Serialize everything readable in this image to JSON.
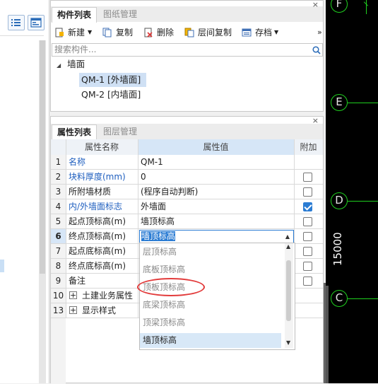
{
  "drawing": {
    "axes": [
      "F",
      "E",
      "D",
      "C"
    ],
    "dimension": "15000"
  },
  "component_panel": {
    "tabs": [
      "构件列表",
      "图纸管理"
    ],
    "toolbar": {
      "new": "新建",
      "copy": "复制",
      "delete": "删除",
      "floor_copy": "层间复制",
      "save": "存档",
      "more": "»"
    },
    "search_placeholder": "搜索构件...",
    "tree": {
      "root": "墙面",
      "items": [
        "QM-1 [外墙面]",
        "QM-2 [内墙面]"
      ],
      "selected_index": 0
    },
    "close": "×"
  },
  "property_panel": {
    "tabs": [
      "属性列表",
      "图层管理"
    ],
    "close": "×",
    "headers": {
      "name": "属性名称",
      "value": "属性值",
      "extra": "附加"
    },
    "rows": [
      {
        "num": "1",
        "name": "名称",
        "value": "QM-1",
        "blue": true,
        "checkbox": false,
        "checked": false
      },
      {
        "num": "2",
        "name": "块料厚度(mm)",
        "value": "0",
        "blue": true,
        "checkbox": true,
        "checked": false
      },
      {
        "num": "3",
        "name": "所附墙材质",
        "value": "(程序自动判断)",
        "blue": false,
        "checkbox": true,
        "checked": false
      },
      {
        "num": "4",
        "name": "内/外墙面标志",
        "value": "外墙面",
        "blue": true,
        "checkbox": true,
        "checked": true
      },
      {
        "num": "5",
        "name": "起点顶标高(m)",
        "value": "墙顶标高",
        "blue": false,
        "checkbox": true,
        "checked": false
      },
      {
        "num": "6",
        "name": "终点顶标高(m)",
        "value": "墙顶标高",
        "blue": false,
        "checkbox": true,
        "checked": false
      },
      {
        "num": "7",
        "name": "起点底标高(m)",
        "value": "",
        "blue": false,
        "checkbox": true,
        "checked": false
      },
      {
        "num": "8",
        "name": "终点底标高(m)",
        "value": "",
        "blue": false,
        "checkbox": true,
        "checked": false
      },
      {
        "num": "9",
        "name": "备注",
        "value": "",
        "blue": false,
        "checkbox": true,
        "checked": false
      },
      {
        "num": "10",
        "name": "土建业务属性",
        "value": "",
        "blue": false,
        "checkbox": false,
        "checked": false
      },
      {
        "num": "13",
        "name": "显示样式",
        "value": "",
        "blue": false,
        "checkbox": false,
        "checked": false
      }
    ],
    "dropdown": {
      "current": "墙顶标高",
      "options": [
        "层顶标高",
        "底板顶标高",
        "顶板顶标高",
        "底梁顶标高",
        "顶梁顶标高",
        "墙顶标高"
      ],
      "selected_index": 5
    }
  },
  "colors": {
    "link_blue": "#1f5fbf",
    "axis_green": "#1fd01f",
    "highlight_red": "#e23b3b",
    "selection_blue": "#2b7cd3"
  }
}
